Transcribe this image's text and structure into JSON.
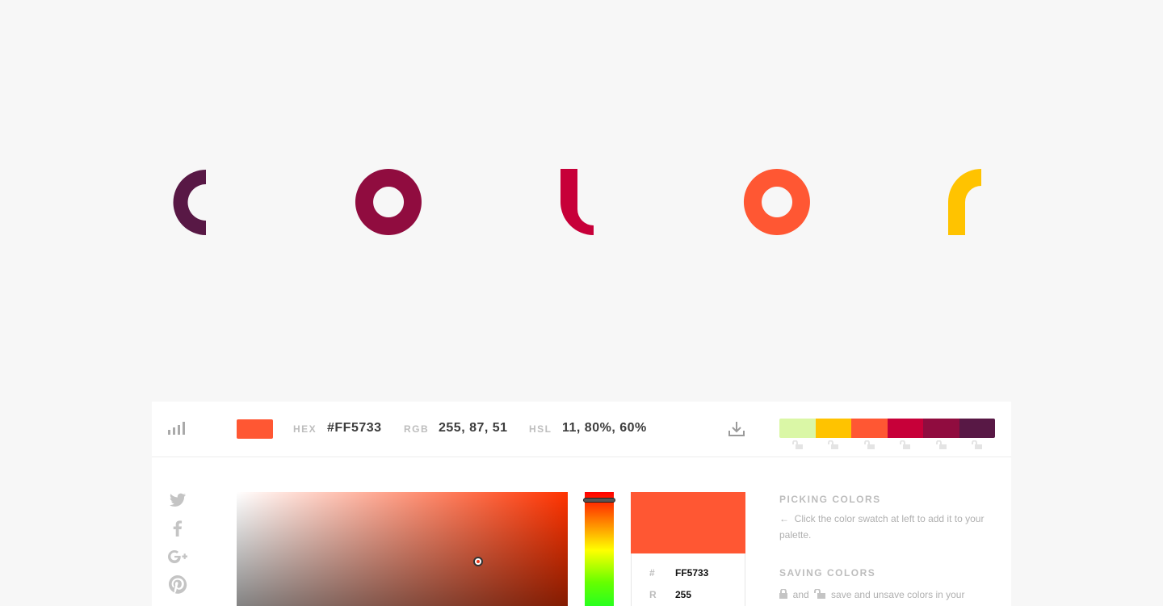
{
  "hero": {
    "title": "color",
    "letter_colors": [
      "#581845",
      "#900C3F",
      "#C70039",
      "#FF5733",
      "#FFC300"
    ]
  },
  "toolbar": {
    "stats_icon": "bar-chart-icon",
    "current_color": "#FF5733",
    "hex_label": "HEX",
    "hex_value": "#FF5733",
    "rgb_label": "RGB",
    "rgb_value": "255, 87, 51",
    "hsl_label": "HSL",
    "hsl_value": "11, 80%, 60%",
    "download_icon": "download-icon"
  },
  "palette": {
    "colors": [
      "#DAF7A6",
      "#FFC300",
      "#FF5733",
      "#C70039",
      "#900C3F",
      "#581845"
    ],
    "lock_icon": "unlocked-icon"
  },
  "social": [
    "twitter-icon",
    "facebook-icon",
    "google-plus-icon",
    "pinterest-icon"
  ],
  "picker": {
    "hue_color": "#FF3300",
    "preview_color": "#FF5733",
    "values": [
      {
        "key": "#",
        "value": "FF5733"
      },
      {
        "key": "R",
        "value": "255"
      }
    ]
  },
  "help": {
    "picking_title": "PICKING COLORS",
    "picking_text": "Click the color swatch at left to add it to your palette.",
    "saving_title": "SAVING COLORS",
    "saving_and": "and",
    "saving_text": "save and unsave colors in your"
  }
}
